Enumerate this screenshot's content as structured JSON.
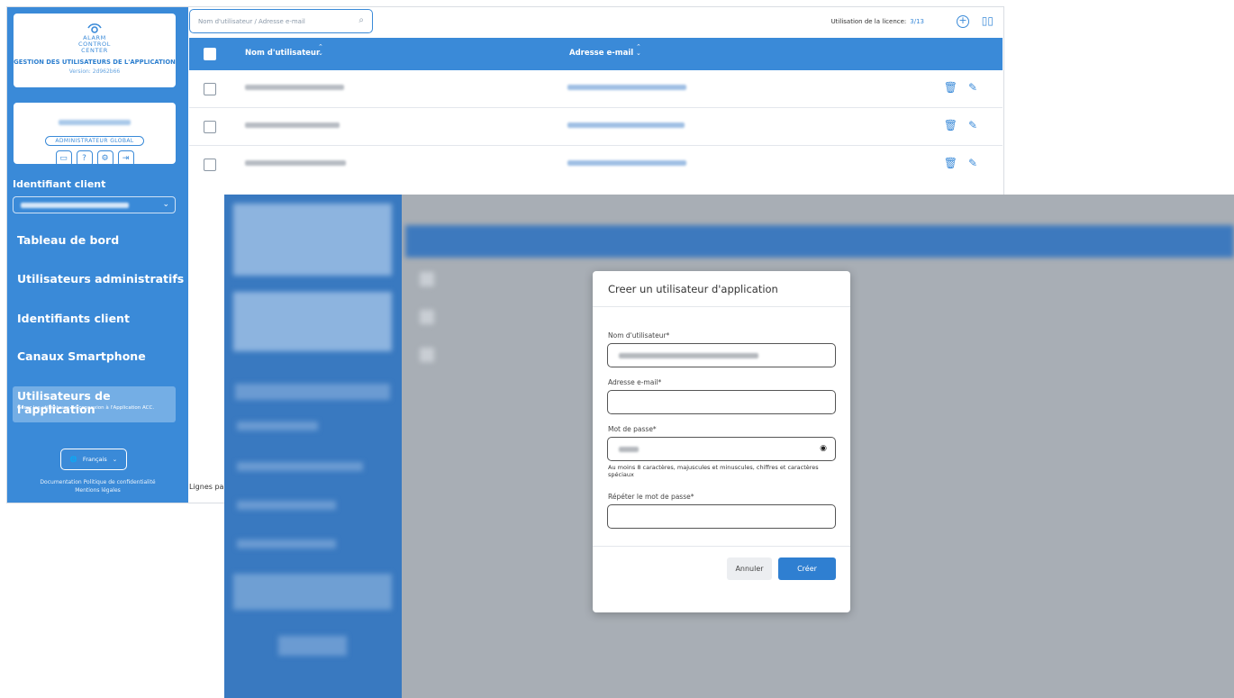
{
  "brand": {
    "logo_lines": [
      "ALARM",
      "CONTROL",
      "CENTER"
    ],
    "subtitle": "GESTION DES UTILISATEURS DE L'APPLICATION",
    "version": "Version: 2d962b66"
  },
  "user": {
    "role": "ADMINISTRATEUR GLOBAL"
  },
  "sidebar": {
    "client_label": "Identifiant client",
    "nav": [
      "Tableau de bord",
      "Utilisateurs administratifs",
      "Identifiants client",
      "Canaux Smartphone"
    ],
    "active_title": "Utilisateurs de l'application",
    "active_desc": "Gérez les utilisateurs de connexion à l'Application ACC.",
    "language": "Français",
    "links_line1": "Documentation   Politique de confidentialité",
    "links_line2": "Mentions légales"
  },
  "toolbar": {
    "search_placeholder": "Nom d'utilisateur / Adresse e-mail",
    "license_label": "Utilisation de la licence:",
    "license_value": "3/13"
  },
  "table": {
    "col_username": "Nom d'utilisateur",
    "col_email": "Adresse e-mail",
    "row_count": 3,
    "pager_label": "Lignes pa"
  },
  "modal": {
    "title": "Creer un utilisateur d'application",
    "username_label": "Nom d'utilisateur*",
    "email_label": "Adresse e-mail*",
    "password_label": "Mot de passe*",
    "password_hint": "Au moins 8 caractères, majuscules et minuscules, chiffres et caractères spéciaux",
    "repeat_label": "Répéter le mot de passe*",
    "cancel": "Annuler",
    "create": "Créer"
  },
  "colors": {
    "primary": "#3a8ad8",
    "sidebar": "#3a8ad8",
    "create_button": "#2f7fd1"
  }
}
